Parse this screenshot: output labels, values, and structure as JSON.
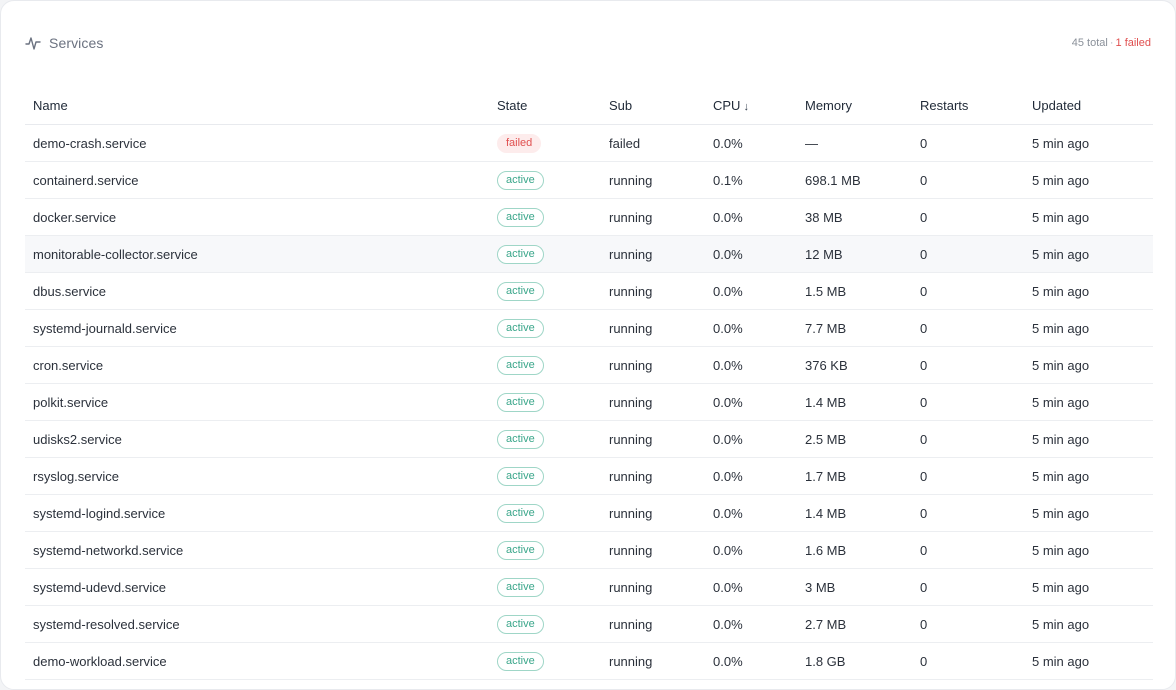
{
  "header": {
    "title": "Services",
    "total": "45 total",
    "separator": "·",
    "failed": "1 failed"
  },
  "colors": {
    "failed": "#e04f4f",
    "active": "#3aa68a"
  },
  "table": {
    "columns": {
      "name": "Name",
      "state": "State",
      "sub": "Sub",
      "cpu": "CPU",
      "cpu_sort_arrow": "↓",
      "memory": "Memory",
      "restarts": "Restarts",
      "updated": "Updated"
    },
    "rows": [
      {
        "name": "demo-crash.service",
        "state": "failed",
        "sub": "failed",
        "cpu": "0.0%",
        "memory": "—",
        "restarts": "0",
        "updated": "5 min ago"
      },
      {
        "name": "containerd.service",
        "state": "active",
        "sub": "running",
        "cpu": "0.1%",
        "memory": "698.1 MB",
        "restarts": "0",
        "updated": "5 min ago"
      },
      {
        "name": "docker.service",
        "state": "active",
        "sub": "running",
        "cpu": "0.0%",
        "memory": "38 MB",
        "restarts": "0",
        "updated": "5 min ago"
      },
      {
        "name": "monitorable-collector.service",
        "state": "active",
        "sub": "running",
        "cpu": "0.0%",
        "memory": "12 MB",
        "restarts": "0",
        "updated": "5 min ago"
      },
      {
        "name": "dbus.service",
        "state": "active",
        "sub": "running",
        "cpu": "0.0%",
        "memory": "1.5 MB",
        "restarts": "0",
        "updated": "5 min ago"
      },
      {
        "name": "systemd-journald.service",
        "state": "active",
        "sub": "running",
        "cpu": "0.0%",
        "memory": "7.7 MB",
        "restarts": "0",
        "updated": "5 min ago"
      },
      {
        "name": "cron.service",
        "state": "active",
        "sub": "running",
        "cpu": "0.0%",
        "memory": "376 KB",
        "restarts": "0",
        "updated": "5 min ago"
      },
      {
        "name": "polkit.service",
        "state": "active",
        "sub": "running",
        "cpu": "0.0%",
        "memory": "1.4 MB",
        "restarts": "0",
        "updated": "5 min ago"
      },
      {
        "name": "udisks2.service",
        "state": "active",
        "sub": "running",
        "cpu": "0.0%",
        "memory": "2.5 MB",
        "restarts": "0",
        "updated": "5 min ago"
      },
      {
        "name": "rsyslog.service",
        "state": "active",
        "sub": "running",
        "cpu": "0.0%",
        "memory": "1.7 MB",
        "restarts": "0",
        "updated": "5 min ago"
      },
      {
        "name": "systemd-logind.service",
        "state": "active",
        "sub": "running",
        "cpu": "0.0%",
        "memory": "1.4 MB",
        "restarts": "0",
        "updated": "5 min ago"
      },
      {
        "name": "systemd-networkd.service",
        "state": "active",
        "sub": "running",
        "cpu": "0.0%",
        "memory": "1.6 MB",
        "restarts": "0",
        "updated": "5 min ago"
      },
      {
        "name": "systemd-udevd.service",
        "state": "active",
        "sub": "running",
        "cpu": "0.0%",
        "memory": "3 MB",
        "restarts": "0",
        "updated": "5 min ago"
      },
      {
        "name": "systemd-resolved.service",
        "state": "active",
        "sub": "running",
        "cpu": "0.0%",
        "memory": "2.7 MB",
        "restarts": "0",
        "updated": "5 min ago"
      },
      {
        "name": "demo-workload.service",
        "state": "active",
        "sub": "running",
        "cpu": "0.0%",
        "memory": "1.8 GB",
        "restarts": "0",
        "updated": "5 min ago"
      }
    ]
  }
}
